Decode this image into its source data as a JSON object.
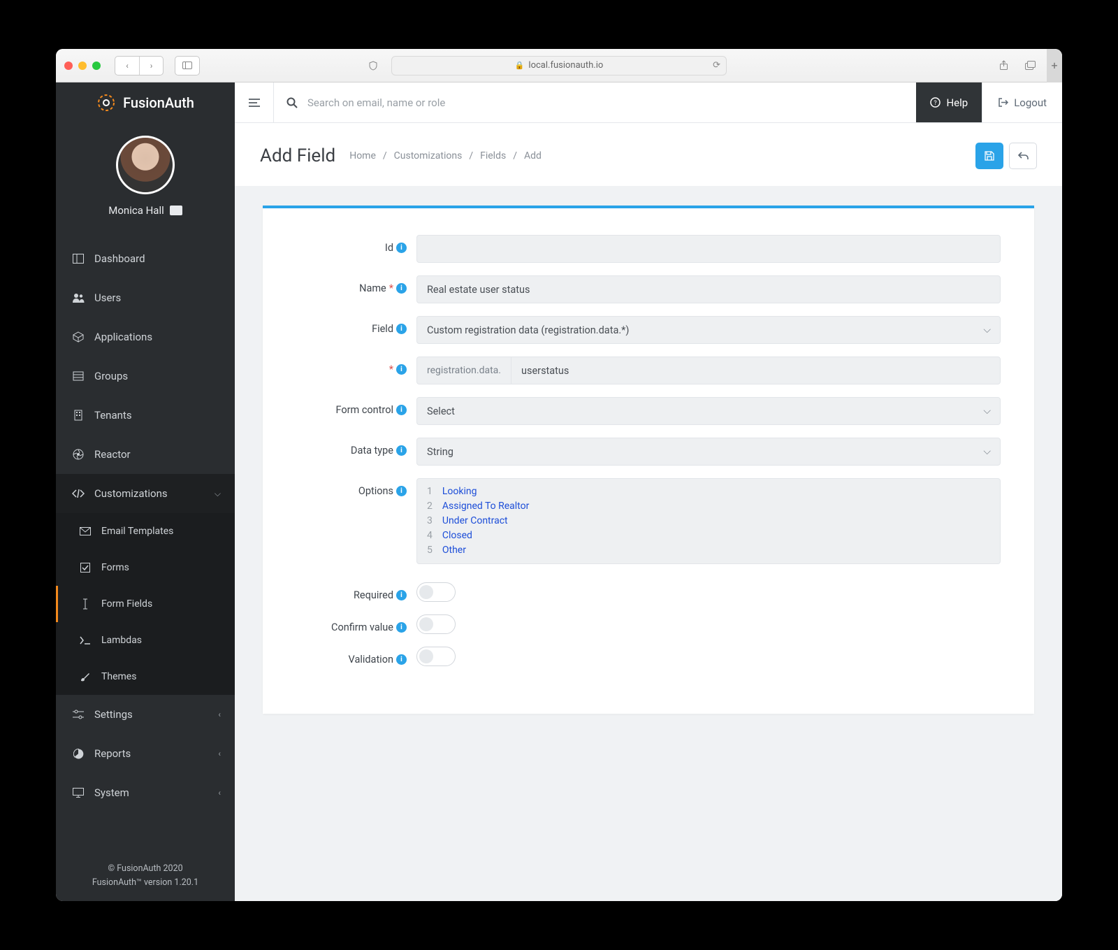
{
  "browser": {
    "url": "local.fusionauth.io"
  },
  "brand": "FusionAuth",
  "user": {
    "name": "Monica Hall"
  },
  "sidebar": {
    "items": [
      {
        "label": "Dashboard"
      },
      {
        "label": "Users"
      },
      {
        "label": "Applications"
      },
      {
        "label": "Groups"
      },
      {
        "label": "Tenants"
      },
      {
        "label": "Reactor"
      },
      {
        "label": "Customizations"
      },
      {
        "label": "Settings"
      },
      {
        "label": "Reports"
      },
      {
        "label": "System"
      }
    ],
    "customizations_sub": [
      {
        "label": "Email Templates"
      },
      {
        "label": "Forms"
      },
      {
        "label": "Form Fields"
      },
      {
        "label": "Lambdas"
      },
      {
        "label": "Themes"
      }
    ],
    "footer_line1": "© FusionAuth 2020",
    "footer_line2": "FusionAuth™ version 1.20.1"
  },
  "topbar": {
    "search_placeholder": "Search on email, name or role",
    "help": "Help",
    "logout": "Logout"
  },
  "page": {
    "title": "Add Field",
    "crumbs": [
      "Home",
      "Customizations",
      "Fields",
      "Add"
    ]
  },
  "form": {
    "labels": {
      "id": "Id",
      "name": "Name",
      "field": "Field",
      "form_control": "Form control",
      "data_type": "Data type",
      "options": "Options",
      "required": "Required",
      "confirm": "Confirm value",
      "validation": "Validation"
    },
    "values": {
      "id": "",
      "name": "Real estate user status",
      "field": "Custom registration data (registration.data.*)",
      "prefix": "registration.data.",
      "key": "userstatus",
      "form_control": "Select",
      "data_type": "String",
      "options": [
        "Looking",
        "Assigned To Realtor",
        "Under Contract",
        "Closed",
        "Other"
      ]
    }
  }
}
